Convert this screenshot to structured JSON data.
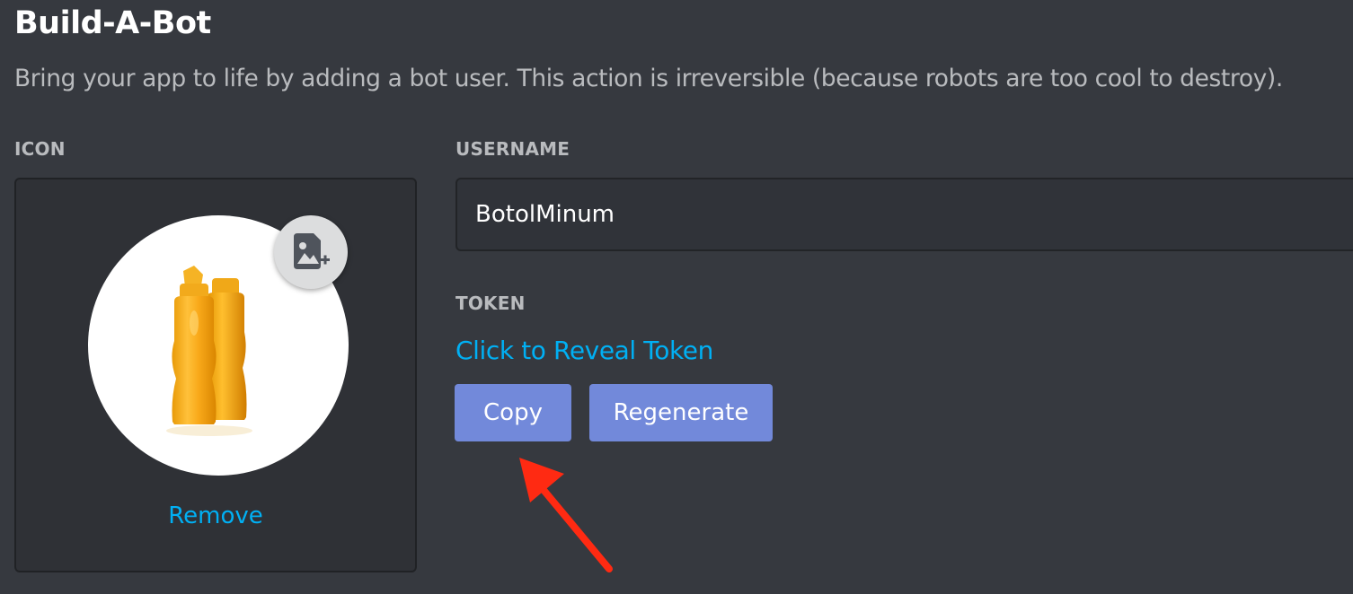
{
  "header": {
    "title": "Build-A-Bot",
    "subtitle": "Bring your app to life by adding a bot user. This action is irreversible (because robots are too cool to destroy)."
  },
  "icon_section": {
    "label": "ICON",
    "avatar_icon": "orange-water-bottles-image",
    "upload_icon": "image-add-icon",
    "remove_label": "Remove"
  },
  "username_section": {
    "label": "USERNAME",
    "value": "BotolMinum"
  },
  "token_section": {
    "label": "TOKEN",
    "reveal_label": "Click to Reveal Token",
    "copy_label": "Copy",
    "regenerate_label": "Regenerate"
  },
  "annotation": {
    "arrow_icon": "red-arrow-pointer",
    "arrow_color": "#ff2a12"
  },
  "colors": {
    "background": "#36393f",
    "panel": "#2f3136",
    "link": "#00b0f4",
    "button": "#7289da",
    "label": "#b9bbbe"
  }
}
